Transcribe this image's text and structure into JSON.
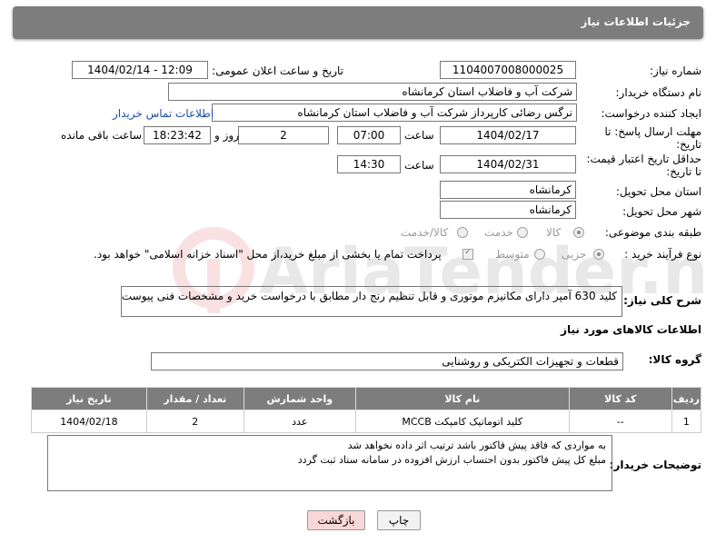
{
  "header": {
    "title": "جزئیات اطلاعات نیاز"
  },
  "fields": {
    "need_no_label": "شماره نیاز:",
    "need_no": "1104007008000025",
    "announce_label": "تاریخ و ساعت اعلان عمومی:",
    "announce_value": "1404/02/14 - 12:09",
    "buyer_label": "نام دستگاه خریدار:",
    "buyer_value": "شرکت آب و فاضلاب استان کرمانشاه",
    "creator_label": "ایجاد کننده درخواست:",
    "creator_value": "نرگس رضائی کارپرداز شرکت آب و فاضلاب استان کرمانشاه",
    "contact_link": "اطلاعات تماس خریدار",
    "deadline_label_1": "مهلت ارسال پاسخ: تا",
    "deadline_label_2": "تاریخ:",
    "deadline_date": "1404/02/17",
    "time_label": "ساعت",
    "deadline_time": "07:00",
    "days_value": "2",
    "days_label": "روز و",
    "remaining_time": "18:23:42",
    "remaining_label": "ساعت باقی مانده",
    "price_label_1": "حداقل تاریخ اعتبار قیمت:",
    "price_label_2": "تا تاریخ:",
    "price_date": "1404/02/31",
    "price_time": "14:30",
    "province_label": "استان محل تحویل:",
    "province_value": "کرمانشاه",
    "city_label": "شهر محل تحویل:",
    "city_value": "کرمانشاه",
    "category_label": "طبقه بندی موضوعی:",
    "cat_goods": "کالا",
    "cat_service": "خدمت",
    "cat_both": "کالا/خدمت",
    "process_label": "نوع فرآیند خرید :",
    "proc_small": "جزیی",
    "proc_medium": "متوسط",
    "payment_note": "پرداخت تمام یا بخشی از مبلغ خرید،از محل \"اسناد خزانه اسلامی\" خواهد بود."
  },
  "description": {
    "label": "شرح کلی نیاز:",
    "text": "کلید 630 آمپر دارای مکانیزم موتوری و قابل تنظیم رنج دار مطابق با درخواست خرید و مشخصات فنی پیوست"
  },
  "goods_info": {
    "title": "اطلاعات کالاهای مورد نیاز",
    "group_label": "گروه کالا:",
    "group_value": "قطعات و تجهیزات الکتریکی و روشنایی"
  },
  "table": {
    "headers": [
      "ردیف",
      "کد کالا",
      "نام کالا",
      "واحد شمارش",
      "تعداد / مقدار",
      "تاریخ نیاز"
    ],
    "rows": [
      {
        "row": "1",
        "code": "--",
        "name": "کلید اتوماتیک کامپکت MCCB",
        "unit": "عدد",
        "qty": "2",
        "date": "1404/02/18"
      }
    ]
  },
  "buyer_notes": {
    "label": "توضیحات خریدار:",
    "line1": "به مواردی که فاقد پیش فاکتور باشد ترتیب اثر داده نخواهد شد",
    "line2": "مبلغ کل پیش فاکتور بدون احتساب ارزش افزوده در سامانه ستاد ثبت گردد"
  },
  "buttons": {
    "print": "چاپ",
    "back": "بازگشت"
  },
  "watermark": {
    "text": "AriaTender.net"
  },
  "colors": {
    "header_bg": "#7d7d7d",
    "link": "#1a4ea8",
    "back_button_bg": "#f8d7d7"
  }
}
